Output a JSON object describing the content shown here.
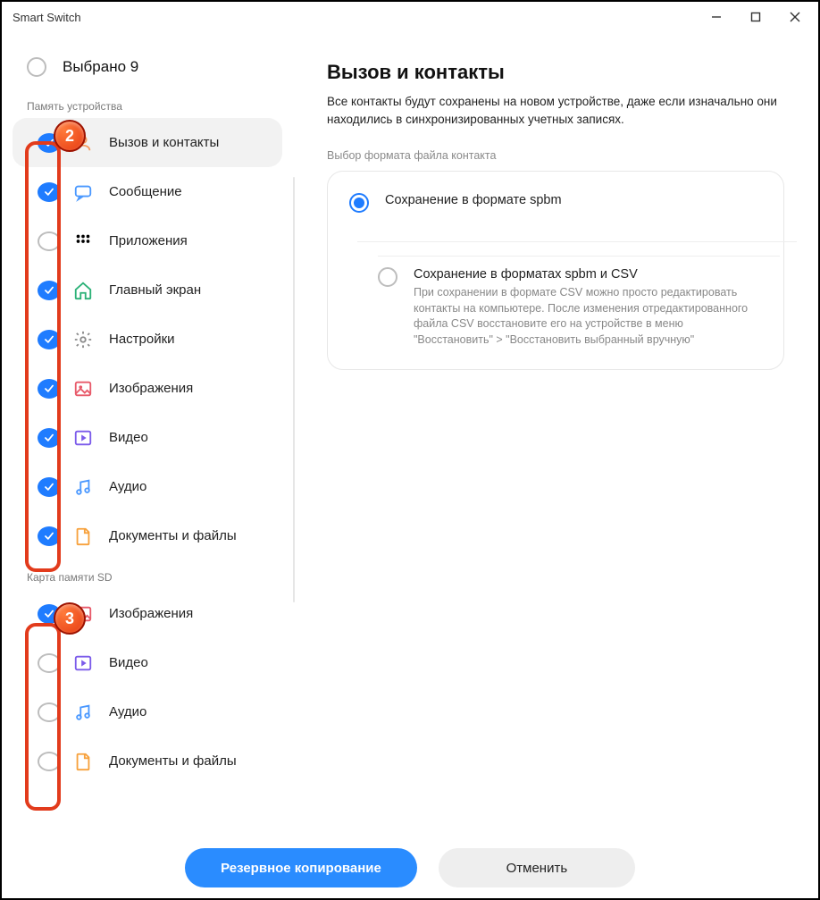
{
  "window": {
    "title": "Smart Switch"
  },
  "sidebar": {
    "select_all": "Выбрано 9",
    "section1_header": "Память устройства",
    "section2_header": "Карта памяти SD",
    "items1": [
      {
        "label": "Вызов и контакты",
        "checked": true,
        "selected": true,
        "icon": "contact",
        "color": "#f49b5f"
      },
      {
        "label": "Сообщение",
        "checked": true,
        "icon": "message",
        "color": "#4a98ff"
      },
      {
        "label": "Приложения",
        "checked": false,
        "icon": "apps",
        "color": "#f49b5f"
      },
      {
        "label": "Главный экран",
        "checked": true,
        "icon": "home",
        "color": "#2bb177"
      },
      {
        "label": "Настройки",
        "checked": true,
        "icon": "settings",
        "color": "#8a8a8a"
      },
      {
        "label": "Изображения",
        "checked": true,
        "icon": "image",
        "color": "#e85a6a"
      },
      {
        "label": "Видео",
        "checked": true,
        "icon": "video",
        "color": "#7b5bea"
      },
      {
        "label": "Аудио",
        "checked": true,
        "icon": "audio",
        "color": "#4a98ff"
      },
      {
        "label": "Документы и файлы",
        "checked": true,
        "icon": "doc",
        "color": "#f7a13c"
      }
    ],
    "items2": [
      {
        "label": "Изображения",
        "checked": true,
        "icon": "image",
        "color": "#e85a6a"
      },
      {
        "label": "Видео",
        "checked": false,
        "icon": "video",
        "color": "#7b5bea"
      },
      {
        "label": "Аудио",
        "checked": false,
        "icon": "audio",
        "color": "#4a98ff"
      },
      {
        "label": "Документы и файлы",
        "checked": false,
        "icon": "doc",
        "color": "#f7a13c"
      }
    ]
  },
  "main": {
    "heading": "Вызов и контакты",
    "description": "Все контакты будут сохранены на новом устройстве, даже если изначально они находились в синхронизированных учетных записях.",
    "subheading": "Выбор формата файла контакта",
    "opt1_title": "Сохранение в формате spbm",
    "opt2_title": "Сохранение в форматах spbm и CSV",
    "opt2_desc": "При сохранении в формате CSV можно просто редактировать контакты на компьютере. После изменения отредактированного файла CSV восстановите его на устройстве в меню \"Восстановить\" > \"Восстановить выбранный вручную\""
  },
  "footer": {
    "primary": "Резервное копирование",
    "secondary": "Отменить"
  },
  "callouts": {
    "c2": "2",
    "c3": "3"
  }
}
